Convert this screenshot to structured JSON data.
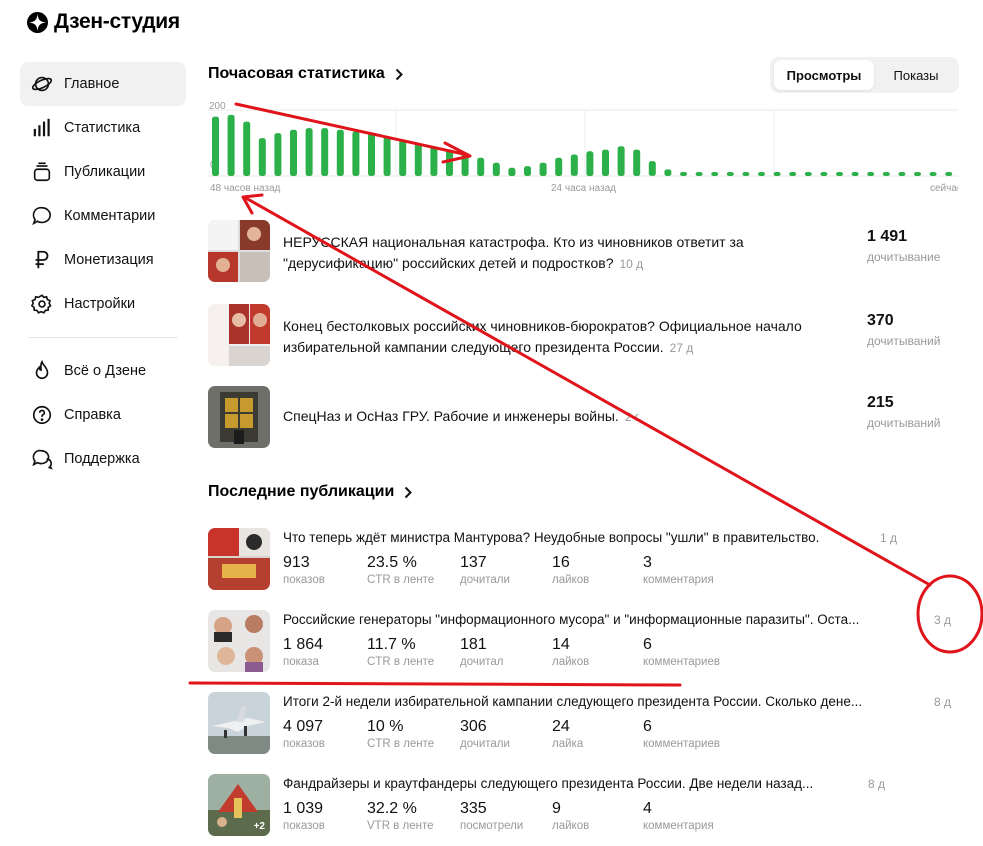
{
  "app": {
    "title": "Дзен-студия"
  },
  "sidebar": {
    "items": [
      {
        "label": "Главное",
        "icon": "planet-icon"
      },
      {
        "label": "Статистика",
        "icon": "bar-chart-icon"
      },
      {
        "label": "Публикации",
        "icon": "stack-icon"
      },
      {
        "label": "Комментарии",
        "icon": "comment-icon"
      },
      {
        "label": "Монетизация",
        "icon": "ruble-icon"
      },
      {
        "label": "Настройки",
        "icon": "gear-icon"
      }
    ],
    "secondary": [
      {
        "label": "Всё о Дзене",
        "icon": "flame-icon"
      },
      {
        "label": "Справка",
        "icon": "question-icon"
      },
      {
        "label": "Поддержка",
        "icon": "support-chat-icon"
      }
    ]
  },
  "hourly": {
    "title": "Почасовая статистика",
    "tabs": [
      "Просмотры",
      "Показы"
    ],
    "active_tab": "Просмотры",
    "y_max_label": "200",
    "y_min_label": "0",
    "x_labels": [
      "48 часов назад",
      "24 часа назад",
      "сейчас"
    ]
  },
  "chart_data": {
    "type": "bar",
    "title": "Почасовая статистика",
    "ylim": [
      0,
      200
    ],
    "values": [
      180,
      185,
      165,
      115,
      130,
      140,
      145,
      145,
      140,
      135,
      130,
      120,
      110,
      100,
      90,
      80,
      70,
      55,
      40,
      25,
      30,
      40,
      55,
      65,
      75,
      80,
      90,
      80,
      45,
      20,
      12,
      10,
      9,
      9,
      8,
      8,
      8,
      8,
      8,
      8,
      8,
      8,
      8,
      8,
      8,
      8,
      8,
      8,
      8,
      8
    ],
    "color": "#2cb049"
  },
  "top_posts": [
    {
      "title": "НЕРУССКАЯ национальная катастрофа. Кто из чиновников ответит за \"дерусификацию\" российских детей и подростков?",
      "age": "10 д",
      "value": "1 491",
      "label": "дочитывание"
    },
    {
      "title": "Конец бестолковых российских чиновников-бюрократов? Официальное начало избирательной кампании следующего президента России.",
      "age": "27 д",
      "value": "370",
      "label": "дочитываний"
    },
    {
      "title": "СпецНаз и ОсНаз ГРУ. Рабочие и инженеры войны.",
      "age": "2 г",
      "value": "215",
      "label": "дочитываний"
    }
  ],
  "recent": {
    "title": "Последние публикации",
    "posts": [
      {
        "title": "Что теперь ждёт министра Мантурова? Неудобные вопросы \"ушли\" в правительство.",
        "age": "1 д",
        "stats": [
          {
            "v": "913",
            "l": "показов"
          },
          {
            "v": "23.5 %",
            "l": "CTR в ленте"
          },
          {
            "v": "137",
            "l": "дочитали"
          },
          {
            "v": "16",
            "l": "лайков"
          },
          {
            "v": "3",
            "l": "комментария"
          }
        ]
      },
      {
        "title": "Российские генераторы \"информационного мусора\" и \"информационные паразиты\". Оста...",
        "age": "3 д",
        "stats": [
          {
            "v": "1 864",
            "l": "показа"
          },
          {
            "v": "11.7 %",
            "l": "CTR в ленте"
          },
          {
            "v": "181",
            "l": "дочитал"
          },
          {
            "v": "14",
            "l": "лайков"
          },
          {
            "v": "6",
            "l": "комментариев"
          }
        ]
      },
      {
        "title": "Итоги 2-й недели избирательной кампании следующего президента России. Сколько дене...",
        "age": "8 д",
        "stats": [
          {
            "v": "4 097",
            "l": "показов"
          },
          {
            "v": "10 %",
            "l": "CTR в ленте"
          },
          {
            "v": "306",
            "l": "дочитали"
          },
          {
            "v": "24",
            "l": "лайка"
          },
          {
            "v": "6",
            "l": "комментариев"
          }
        ]
      },
      {
        "title": "Фандрайзеры и краутфандеры следующего президента России. Две недели назад...",
        "age": "8 д",
        "thumb_badge": "+2",
        "stats": [
          {
            "v": "1 039",
            "l": "показов"
          },
          {
            "v": "32.2 %",
            "l": "VTR в ленте"
          },
          {
            "v": "335",
            "l": "посмотрели"
          },
          {
            "v": "9",
            "l": "лайков"
          },
          {
            "v": "4",
            "l": "комментария"
          }
        ]
      }
    ]
  },
  "colors": {
    "bar": "#2cb049",
    "annotation": "#e0151c",
    "muted": "#999999",
    "active_bg": "#f1f1f2"
  }
}
